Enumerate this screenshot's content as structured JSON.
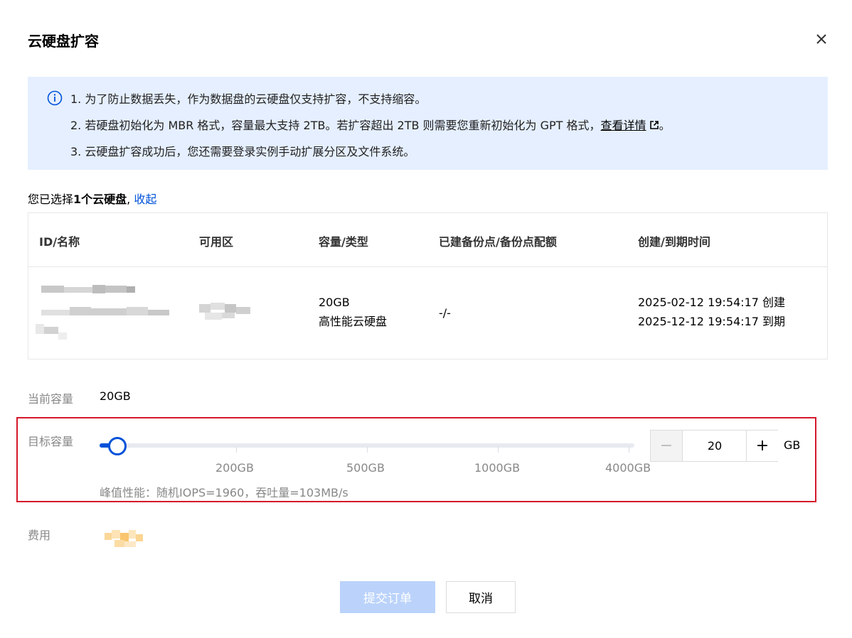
{
  "dialog": {
    "title": "云硬盘扩容",
    "close_icon": "close-icon"
  },
  "notice": {
    "icon": "info-icon",
    "line1": "1. 为了防止数据丢失，作为数据盘的云硬盘仅支持扩容，不支持缩容。",
    "line2_prefix": "2. 若硬盘初始化为 MBR 格式，容量最大支持 2TB。若扩容超出 2TB 则需要您重新初始化为 GPT 格式，",
    "line2_link": "查看详情",
    "line2_suffix": "。",
    "line3": "3. 云硬盘扩容成功后，您还需要登录实例手动扩展分区及文件系统。"
  },
  "selection": {
    "prefix": "您已选择",
    "count_text": "1个云硬盘",
    "separator": ",",
    "collapse_link": "收起"
  },
  "table": {
    "headers": [
      "ID/名称",
      "可用区",
      "容量/类型",
      "已建备份点/备份点配额",
      "创建/到期时间"
    ],
    "row": {
      "capacity": "20GB",
      "type": "高性能云硬盘",
      "backups": "-/-",
      "created": "2025-02-12 19:54:17 创建",
      "expires": "2025-12-12 19:54:17 到期"
    }
  },
  "current_capacity": {
    "label": "当前容量",
    "value": "20GB"
  },
  "target_capacity": {
    "label": "目标容量",
    "value": "20",
    "unit": "GB",
    "ticks": [
      "200GB",
      "500GB",
      "1000GB",
      "4000GB"
    ],
    "performance": "峰值性能：随机IOPS=1960，吞吐量=103MB/s"
  },
  "fee": {
    "label": "费用"
  },
  "buttons": {
    "submit": "提交订单",
    "cancel": "取消"
  },
  "colors": {
    "accent": "#0052d9",
    "notice_bg": "#e5efff",
    "highlight_border": "#d5182a",
    "submit_disabled": "#bbd3fb"
  }
}
